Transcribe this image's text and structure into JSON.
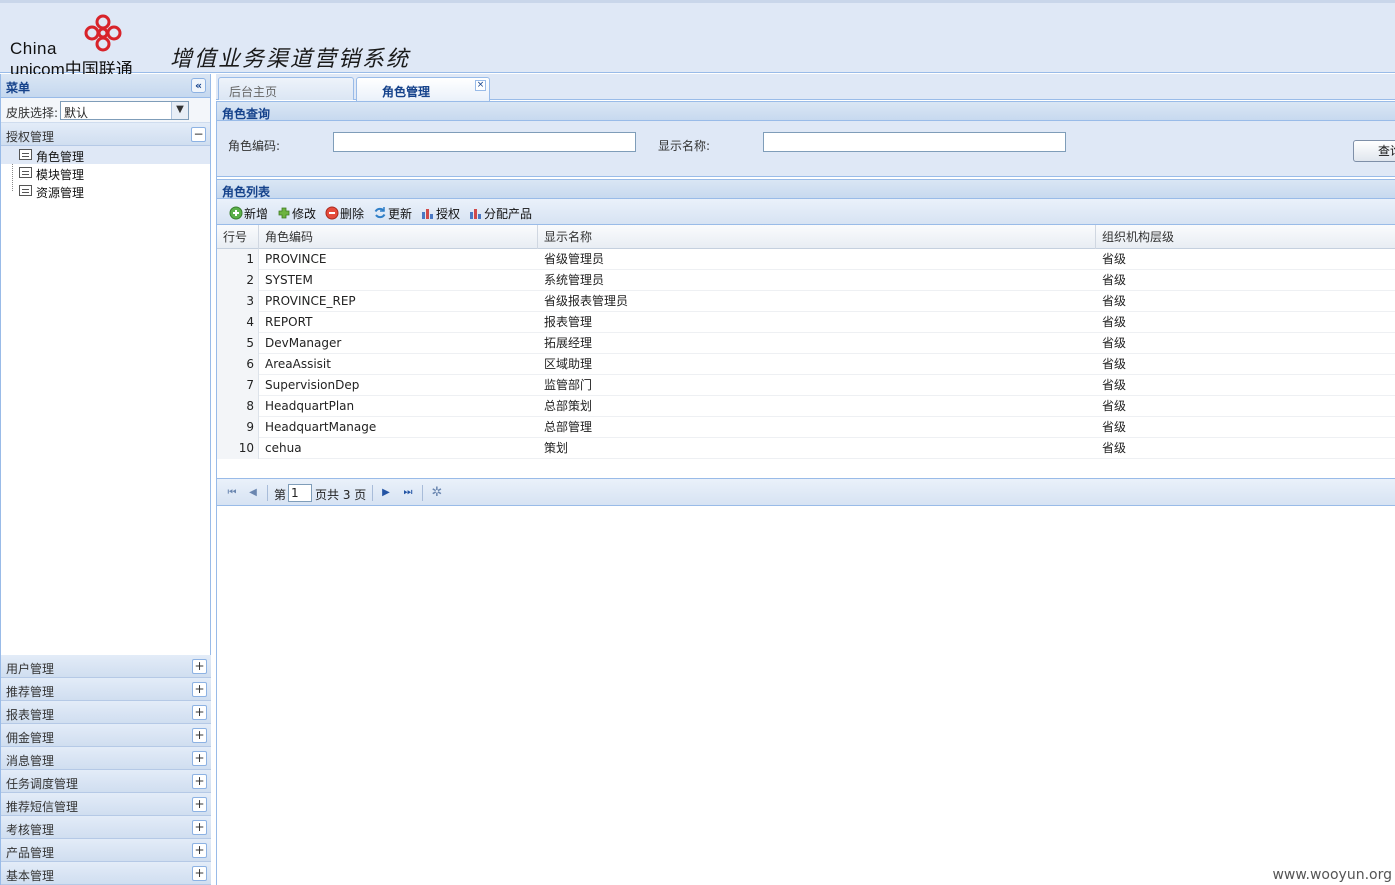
{
  "header": {
    "logo_line1": "China",
    "logo_line2": "unicom中国联通",
    "system_title": "增值业务渠道营销系统",
    "logo_color": "#d8232a"
  },
  "sidebar": {
    "title": "菜单",
    "collapse_icon": "double-chevron-left-icon",
    "skin_label": "皮肤选择:",
    "skin_value": "默认",
    "open_section": {
      "label": "授权管理",
      "items": [
        {
          "label": "角色管理",
          "selected": true
        },
        {
          "label": "模块管理",
          "selected": false
        },
        {
          "label": "资源管理",
          "selected": false
        }
      ]
    },
    "sections": [
      {
        "label": "用户管理"
      },
      {
        "label": "推荐管理"
      },
      {
        "label": "报表管理"
      },
      {
        "label": "佣金管理"
      },
      {
        "label": "消息管理"
      },
      {
        "label": "任务调度管理"
      },
      {
        "label": "推荐短信管理"
      },
      {
        "label": "考核管理"
      },
      {
        "label": "产品管理"
      },
      {
        "label": "基本管理"
      }
    ]
  },
  "tabs": [
    {
      "label": "后台主页",
      "active": false
    },
    {
      "label": "角色管理",
      "active": true
    }
  ],
  "query": {
    "title": "角色查询",
    "code_label": "角色编码:",
    "code_value": "",
    "name_label": "显示名称:",
    "name_value": "",
    "search_label": "查询"
  },
  "list": {
    "title": "角色列表",
    "toolbar": [
      {
        "label": "新增",
        "icon": "add-icon"
      },
      {
        "label": "修改",
        "icon": "edit-icon"
      },
      {
        "label": "删除",
        "icon": "delete-icon"
      },
      {
        "label": "更新",
        "icon": "refresh-icon"
      },
      {
        "label": "授权",
        "icon": "chart-icon"
      },
      {
        "label": "分配产品",
        "icon": "chart-icon"
      }
    ],
    "columns": [
      "行号",
      "角色编码",
      "显示名称",
      "组织机构层级"
    ],
    "rows": [
      {
        "n": "1",
        "code": "PROVINCE",
        "name": "省级管理员",
        "level": "省级"
      },
      {
        "n": "2",
        "code": "SYSTEM",
        "name": "系统管理员",
        "level": "省级"
      },
      {
        "n": "3",
        "code": "PROVINCE_REP",
        "name": "省级报表管理员",
        "level": "省级"
      },
      {
        "n": "4",
        "code": "REPORT",
        "name": "报表管理",
        "level": "省级"
      },
      {
        "n": "5",
        "code": "DevManager",
        "name": "拓展经理",
        "level": "省级"
      },
      {
        "n": "6",
        "code": "AreaAssisit",
        "name": "区域助理",
        "level": "省级"
      },
      {
        "n": "7",
        "code": "SupervisionDep",
        "name": "监管部门",
        "level": "省级"
      },
      {
        "n": "8",
        "code": "HeadquartPlan",
        "name": "总部策划",
        "level": "省级"
      },
      {
        "n": "9",
        "code": "HeadquartManage",
        "name": "总部管理",
        "level": "省级"
      },
      {
        "n": "10",
        "code": "cehua",
        "name": "策划",
        "level": "省级"
      }
    ]
  },
  "pager": {
    "page_prefix": "第",
    "page_value": "1",
    "page_suffix": "页共 3 页"
  },
  "watermark": "www.wooyun.org"
}
